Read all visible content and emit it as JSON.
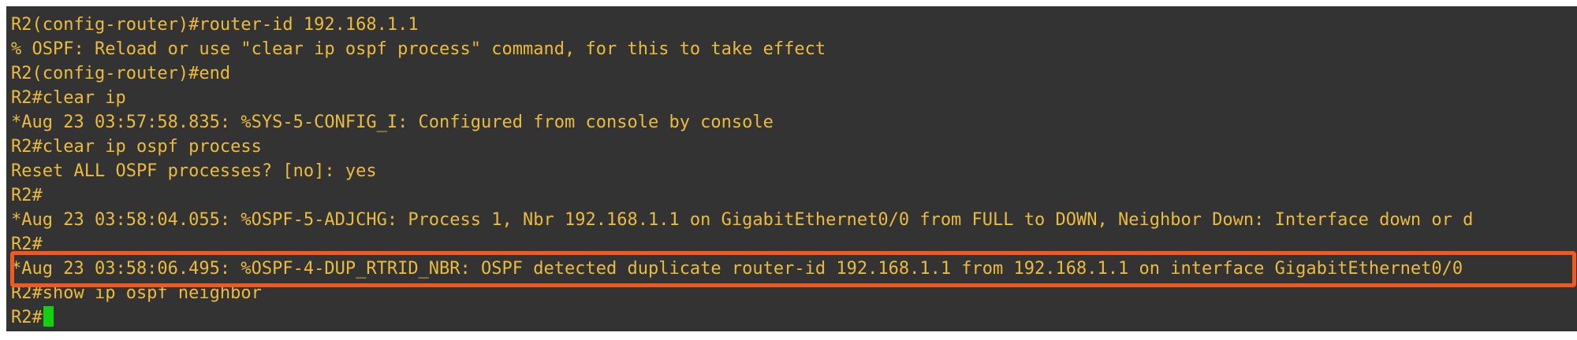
{
  "terminal": {
    "lines": [
      "R2(config-router)#router-id 192.168.1.1",
      "% OSPF: Reload or use \"clear ip ospf process\" command, for this to take effect",
      "R2(config-router)#end",
      "R2#clear ip",
      "*Aug 23 03:57:58.835: %SYS-5-CONFIG_I: Configured from console by console",
      "R2#clear ip ospf process",
      "Reset ALL OSPF processes? [no]: yes",
      "R2#",
      "*Aug 23 03:58:04.055: %OSPF-5-ADJCHG: Process 1, Nbr 192.168.1.1 on GigabitEthernet0/0 from FULL to DOWN, Neighbor Down: Interface down or d",
      "R2#",
      "*Aug 23 03:58:06.495: %OSPF-4-DUP_RTRID_NBR: OSPF detected duplicate router-id 192.168.1.1 from 192.168.1.1 on interface GigabitEthernet0/0",
      "R2#show ip ospf neighbor",
      "R2#"
    ],
    "colors": {
      "background": "#333333",
      "text": "#ebbc3c",
      "cursor": "#12d10f",
      "highlight": "#f05a1e"
    }
  }
}
